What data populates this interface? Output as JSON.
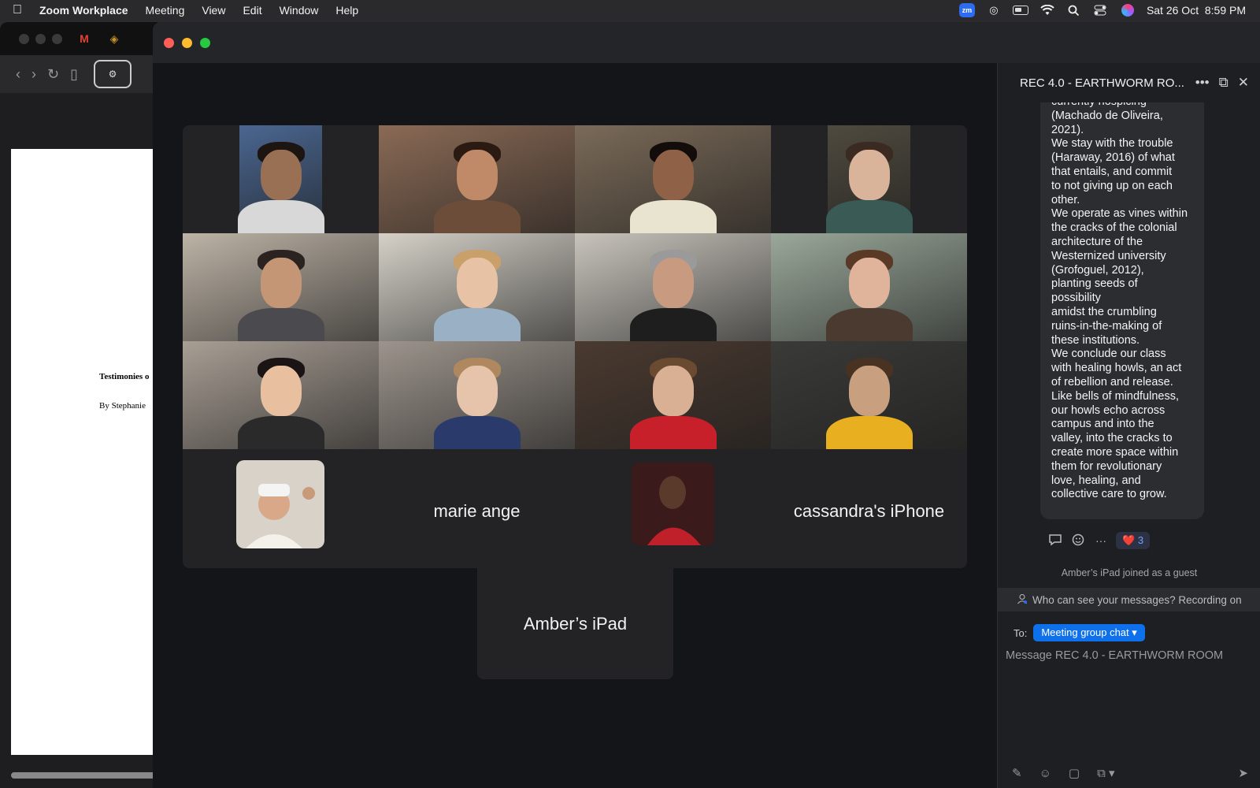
{
  "menubar": {
    "apple": "",
    "app": "Zoom Workplace",
    "items": [
      "Meeting",
      "View",
      "Edit",
      "Window",
      "Help"
    ],
    "status_icons": {
      "zoom": "zm",
      "creative_cloud": "creative-cloud-icon",
      "battery": "battery-icon",
      "wifi": "wifi-icon",
      "search": "spotlight-icon",
      "control_center": "control-center-icon",
      "siri": "siri-icon"
    },
    "datetime": "Sat 26 Oct  8:59 PM"
  },
  "background_doc": {
    "title_fragment": "Testimonies o",
    "byline_fragment": "By Stephanie"
  },
  "gallery": {
    "tiles": [
      {
        "name": "participant-1",
        "skin": "#9a7055",
        "bg": "#4a6690",
        "hair": "#1c1512",
        "shirt": "#d8d8d8",
        "narrow": true
      },
      {
        "name": "participant-2",
        "skin": "#c08a68",
        "bg": "#8a6a55",
        "hair": "#2b1a12",
        "shirt": "#6b4d3a",
        "active": true
      },
      {
        "name": "participant-3",
        "skin": "#8f6248",
        "bg": "#7a6a58",
        "hair": "#120d0a",
        "shirt": "#e8e4d0"
      },
      {
        "name": "participant-4",
        "skin": "#d9b49a",
        "bg": "#4f4a3f",
        "hair": "#3a2a22",
        "shirt": "#3a5a55",
        "narrow": true
      },
      {
        "name": "participant-5",
        "skin": "#c49676",
        "bg": "#bdb3a6",
        "hair": "#2a2320",
        "shirt": "#4b4b4f"
      },
      {
        "name": "participant-6",
        "skin": "#e8c2a4",
        "bg": "#d5d1c8",
        "hair": "#c9a06a",
        "shirt": "#9ab0c4"
      },
      {
        "name": "participant-7",
        "skin": "#c89a80",
        "bg": "#c8c4bc",
        "hair": "#9a9a9a",
        "shirt": "#1e1e1e"
      },
      {
        "name": "participant-8",
        "skin": "#e0b49a",
        "bg": "#9aa89a",
        "hair": "#5a3a26",
        "shirt": "#4a3a30"
      },
      {
        "name": "participant-9",
        "skin": "#e8c0a0",
        "bg": "#a89e94",
        "hair": "#1a1414",
        "shirt": "#2a2a2a"
      },
      {
        "name": "participant-10",
        "skin": "#e6c4ac",
        "bg": "#9c948c",
        "hair": "#b08860",
        "shirt": "#2a3a6a"
      },
      {
        "name": "participant-11",
        "skin": "#dab094",
        "bg": "#4a3a30",
        "hair": "#6a4a30",
        "shirt": "#c8202a"
      },
      {
        "name": "participant-12",
        "skin": "#c8a080",
        "bg": "#3a3a38",
        "hair": "#4a3222",
        "shirt": "#e8b020"
      }
    ],
    "row4": {
      "avatar_1_colors": [
        "#d8d2c8",
        "#f4f0ea"
      ],
      "name_2": "marie ange",
      "avatar_3_colors": [
        "#3a1a1a",
        "#c0202a"
      ],
      "name_4": "cassandra's iPhone"
    },
    "overflow_name": "Amber’s iPad"
  },
  "chat": {
    "title": "REC 4.0 - EARTHWORM RO...",
    "actions": {
      "more": "•••",
      "popout": "⧉",
      "close": "✕"
    },
    "message_lines": [
      "currently hospicing",
      "(Machado de Oliveira,",
      "2021).",
      "We stay with the trouble",
      "(Haraway, 2016) of what",
      "that entails, and commit",
      "to not giving up on each",
      "other.",
      "We operate as vines within",
      "the cracks of the colonial",
      "architecture of the",
      "Westernized university",
      "(Grofoguel, 2012),",
      "planting seeds of",
      "possibility",
      "amidst the crumbling",
      "ruins-in-the-making of",
      "these institutions.",
      "We conclude our class",
      "with healing howls, an act",
      "of rebellion and release.",
      "Like bells of mindfulness,",
      "our howls echo across",
      "campus and into the",
      "valley, into the cracks to",
      "create more space within",
      "them for revolutionary",
      "love, healing, and",
      "collective care to grow."
    ],
    "reaction": {
      "emoji": "❤️",
      "count": "3"
    },
    "joined_notice": "Amber’s iPad joined as a guest",
    "privacy_notice": "Who can see your messages? Recording on",
    "to_label": "To:",
    "recipient": "Meeting group chat",
    "input_placeholder": "Message REC 4.0 - EARTHWORM ROOM"
  },
  "colors": {
    "active_speaker": "#2ed04a",
    "accent": "#0e71eb",
    "window_bg": "#141518"
  }
}
